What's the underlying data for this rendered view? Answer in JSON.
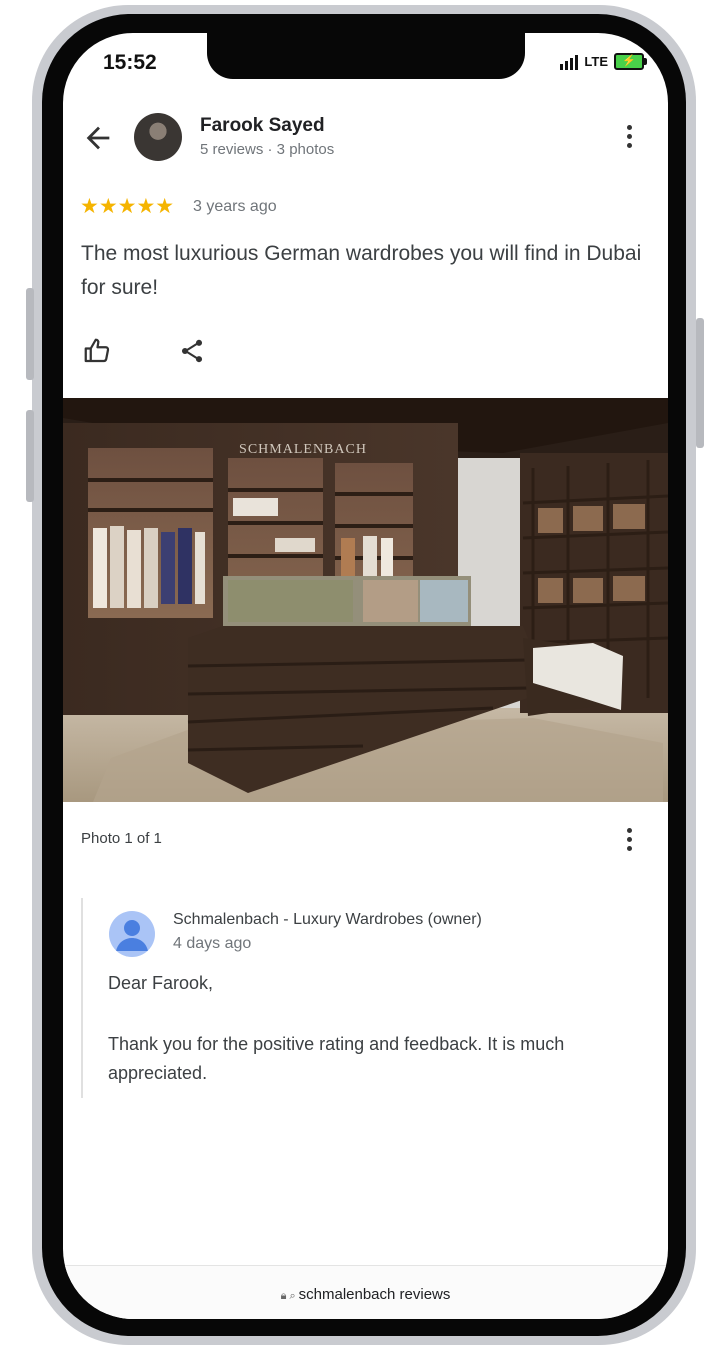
{
  "status_bar": {
    "time": "15:52",
    "network": "LTE"
  },
  "header": {
    "reviewer_name": "Farook Sayed",
    "reviewer_meta": "5 reviews · 3 photos"
  },
  "review": {
    "rating": 5,
    "stars": "★★★★★",
    "time_ago": "3 years ago",
    "text": "The most luxurious German wardrobes you will find in Dubai for sure!"
  },
  "photo": {
    "brand_sign": "SCHMALENBACH",
    "counter": "Photo 1 of 1"
  },
  "owner_reply": {
    "name": "Schmalenbach - Luxury Wardrobes (owner)",
    "time_ago": "4 days ago",
    "greeting": "Dear Farook,",
    "body": "Thank you for the positive rating and feedback. It is much appreciated."
  },
  "browser": {
    "url": "schmalenbach reviews"
  },
  "colors": {
    "star": "#f5b400",
    "text_primary": "#202124",
    "text_secondary": "#70757a",
    "battery": "#49d14a"
  },
  "icons": [
    "back-arrow-icon",
    "kebab-menu-icon",
    "thumbs-up-icon",
    "share-icon",
    "lock-icon",
    "search-icon",
    "person-icon"
  ]
}
